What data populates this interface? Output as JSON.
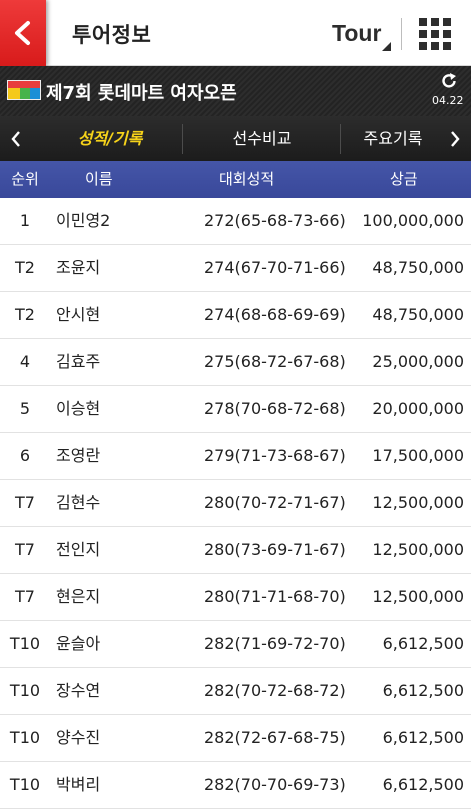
{
  "appbar": {
    "title": "투어정보",
    "logo": "Tour",
    "menu_icon": "grid-icon",
    "back_icon": "back-chevron-icon"
  },
  "tournament": {
    "title": "제7회 롯데마트 여자오픈",
    "date": "04.22",
    "refresh_icon": "refresh-icon"
  },
  "tabs": [
    "성적/기록",
    "선수비교",
    "주요기록"
  ],
  "columns": [
    "순위",
    "이름",
    "대회성적",
    "상금"
  ],
  "rows": [
    {
      "rank": "1",
      "name": "이민영2",
      "score": "272(65-68-73-66)",
      "prize": "100,000,000"
    },
    {
      "rank": "T2",
      "name": "조윤지",
      "score": "274(67-70-71-66)",
      "prize": "48,750,000"
    },
    {
      "rank": "T2",
      "name": "안시현",
      "score": "274(68-68-69-69)",
      "prize": "48,750,000"
    },
    {
      "rank": "4",
      "name": "김효주",
      "score": "275(68-72-67-68)",
      "prize": "25,000,000"
    },
    {
      "rank": "5",
      "name": "이승현",
      "score": "278(70-68-72-68)",
      "prize": "20,000,000"
    },
    {
      "rank": "6",
      "name": "조영란",
      "score": "279(71-73-68-67)",
      "prize": "17,500,000"
    },
    {
      "rank": "T7",
      "name": "김현수",
      "score": "280(70-72-71-67)",
      "prize": "12,500,000"
    },
    {
      "rank": "T7",
      "name": "전인지",
      "score": "280(73-69-71-67)",
      "prize": "12,500,000"
    },
    {
      "rank": "T7",
      "name": "현은지",
      "score": "280(71-71-68-70)",
      "prize": "12,500,000"
    },
    {
      "rank": "T10",
      "name": "윤슬아",
      "score": "282(71-69-72-70)",
      "prize": "6,612,500"
    },
    {
      "rank": "T10",
      "name": "장수연",
      "score": "282(70-72-68-72)",
      "prize": "6,612,500"
    },
    {
      "rank": "T10",
      "name": "양수진",
      "score": "282(72-67-68-75)",
      "prize": "6,612,500"
    },
    {
      "rank": "T10",
      "name": "박벼리",
      "score": "282(70-70-69-73)",
      "prize": "6,612,500"
    }
  ],
  "colors": {
    "accent_red": "#d81b1b",
    "header_blue": "#3f4fa2",
    "active_tab": "#f5d21a"
  }
}
